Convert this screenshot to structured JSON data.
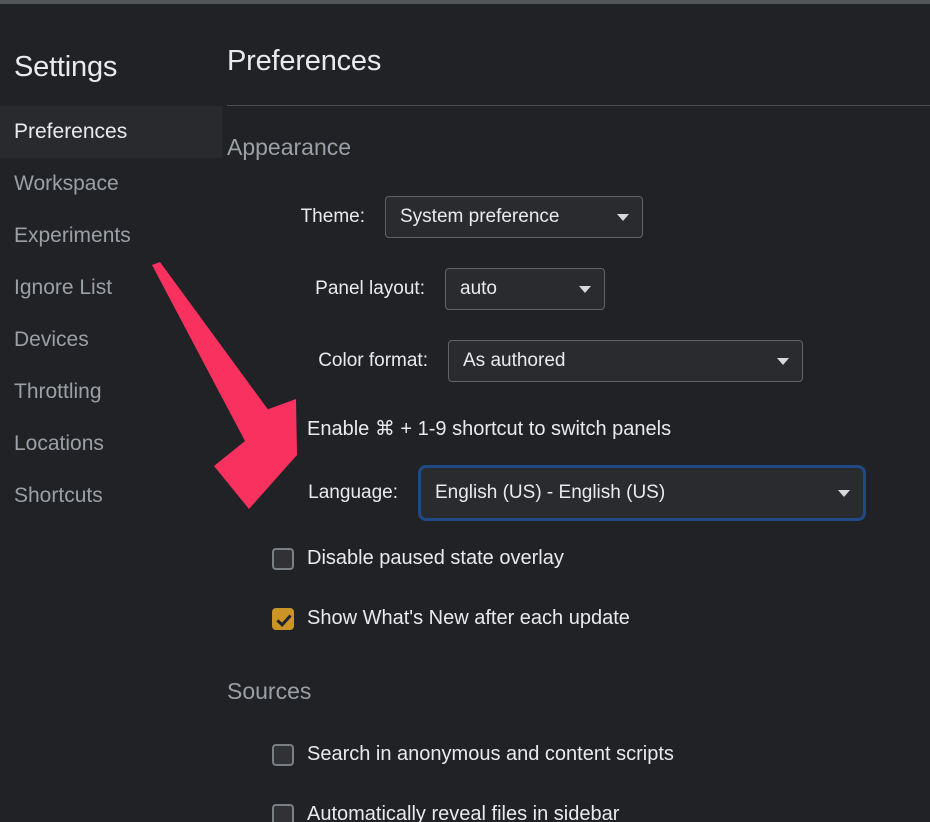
{
  "window": {
    "background_color": "#212226",
    "titlebar_color": "#535659"
  },
  "sidebar": {
    "title": "Settings",
    "items": [
      {
        "label": "Preferences",
        "selected": true
      },
      {
        "label": "Workspace",
        "selected": false
      },
      {
        "label": "Experiments",
        "selected": false
      },
      {
        "label": "Ignore List",
        "selected": false
      },
      {
        "label": "Devices",
        "selected": false
      },
      {
        "label": "Throttling",
        "selected": false
      },
      {
        "label": "Locations",
        "selected": false
      },
      {
        "label": "Shortcuts",
        "selected": false
      }
    ]
  },
  "main": {
    "title": "Preferences",
    "sections": [
      {
        "title": "Appearance",
        "selects": [
          {
            "label": "Theme:",
            "value": "System preference",
            "focused": false
          },
          {
            "label": "Panel layout:",
            "value": "auto",
            "focused": false
          },
          {
            "label": "Color format:",
            "value": "As authored",
            "focused": false
          },
          {
            "label": "Language:",
            "value": "English (US) - English (US)",
            "focused": true
          }
        ],
        "checkboxes": [
          {
            "label": "Enable ⌘ + 1-9 shortcut to switch panels",
            "checked": false
          },
          {
            "label": "Disable paused state overlay",
            "checked": false
          },
          {
            "label": "Show What's New after each update",
            "checked": true
          }
        ]
      },
      {
        "title": "Sources",
        "checkboxes": [
          {
            "label": "Search in anonymous and content scripts",
            "checked": false
          },
          {
            "label": "Automatically reveal files in sidebar",
            "checked": false
          }
        ]
      }
    ]
  },
  "annotation": {
    "arrow_color": "#f9315f",
    "points_at": "Language:"
  },
  "colors": {
    "accent_checkbox": "#cb9427",
    "focus_ring": "#1f4a86",
    "text_primary": "#e8eaed",
    "text_secondary": "#9aa0a6"
  }
}
